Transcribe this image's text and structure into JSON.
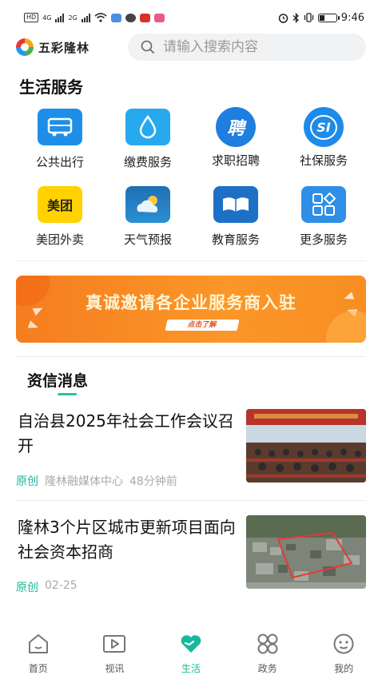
{
  "status_bar": {
    "left_chips": [
      "HD",
      "4G",
      "2G"
    ],
    "time": "9:46"
  },
  "header": {
    "logo_text": "五彩隆林",
    "search_placeholder": "请输入搜索内容"
  },
  "life_services": {
    "title": "生活服务",
    "items": [
      {
        "label": "公共出行",
        "icon": "bus-icon",
        "color": "#1e8ee8"
      },
      {
        "label": "缴费服务",
        "icon": "water-drop-icon",
        "color": "#27a9ee"
      },
      {
        "label": "求职招聘",
        "icon": "recruit-icon",
        "color": "#1f7fe0",
        "glyph": "聘"
      },
      {
        "label": "社保服务",
        "icon": "social-security-icon",
        "color": "#1c8bea",
        "glyph": "SI"
      },
      {
        "label": "美团外卖",
        "icon": "meituan-icon",
        "color": "#ffd200",
        "glyph": "美团"
      },
      {
        "label": "天气预报",
        "icon": "weather-icon",
        "color": "#2475b9"
      },
      {
        "label": "教育服务",
        "icon": "book-icon",
        "color": "#1d70c6"
      },
      {
        "label": "更多服务",
        "icon": "grid-more-icon",
        "color": "#2f8fe6"
      }
    ]
  },
  "banner": {
    "text": "真诚邀请各企业服务商入驻",
    "button": "点击了解"
  },
  "news": {
    "title": "资信消息",
    "items": [
      {
        "headline": "自治县2025年社会工作会议召开",
        "tag": "原创",
        "source": "隆林融媒体中心",
        "time": "48分钟前"
      },
      {
        "headline": "隆林3个片区城市更新项目面向社会资本招商",
        "tag": "原创",
        "source": "",
        "time": "02-25"
      }
    ]
  },
  "bottom_nav": {
    "items": [
      {
        "label": "首页",
        "icon": "home-icon",
        "active": false
      },
      {
        "label": "视讯",
        "icon": "video-icon",
        "active": false
      },
      {
        "label": "生活",
        "icon": "life-heart-icon",
        "active": true
      },
      {
        "label": "政务",
        "icon": "government-icon",
        "active": false
      },
      {
        "label": "我的",
        "icon": "profile-icon",
        "active": false
      }
    ],
    "accent": "#19b89c"
  }
}
